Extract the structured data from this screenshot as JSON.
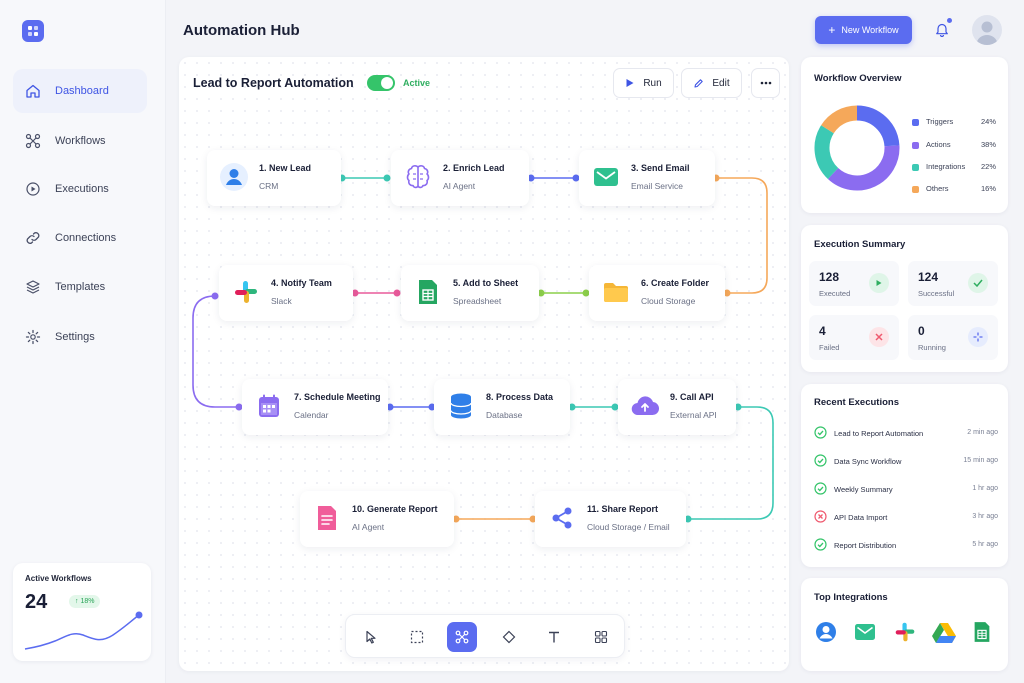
{
  "header": {
    "title": "Automation Hub",
    "new_workflow": "New Workflow"
  },
  "sidebar": {
    "items": [
      {
        "label": "Dashboard",
        "icon": "home-icon"
      },
      {
        "label": "Workflows",
        "icon": "workflow-icon"
      },
      {
        "label": "Executions",
        "icon": "play-circle-icon"
      },
      {
        "label": "Connections",
        "icon": "link-icon"
      },
      {
        "label": "Templates",
        "icon": "layers-icon"
      },
      {
        "label": "Settings",
        "icon": "gear-icon"
      }
    ],
    "active_card": {
      "title": "Active Workflows",
      "value": "24",
      "badge": "↑ 18%"
    }
  },
  "workflow": {
    "title": "Lead to Report Automation",
    "status": "Active",
    "run": "Run",
    "edit": "Edit",
    "nodes": [
      {
        "title": "1. New Lead",
        "sub": "CRM"
      },
      {
        "title": "2. Enrich Lead",
        "sub": "AI Agent"
      },
      {
        "title": "3. Send Email",
        "sub": "Email Service"
      },
      {
        "title": "4. Notify Team",
        "sub": "Slack"
      },
      {
        "title": "5. Add to Sheet",
        "sub": "Spreadsheet"
      },
      {
        "title": "6. Create Folder",
        "sub": "Cloud Storage"
      },
      {
        "title": "7. Schedule Meeting",
        "sub": "Calendar"
      },
      {
        "title": "8. Process Data",
        "sub": "Database"
      },
      {
        "title": "9. Call API",
        "sub": "External API"
      },
      {
        "title": "10. Generate Report",
        "sub": "AI Agent"
      },
      {
        "title": "11. Share Report",
        "sub": "Cloud Storage / Email"
      }
    ]
  },
  "overview": {
    "title": "Workflow Overview",
    "segments": [
      {
        "label": "Triggers",
        "pct": "24%",
        "value": 24,
        "color": "#5b6cf0"
      },
      {
        "label": "Actions",
        "pct": "38%",
        "value": 38,
        "color": "#8b6cf0"
      },
      {
        "label": "Integrations",
        "pct": "22%",
        "value": 22,
        "color": "#3cc9b4"
      },
      {
        "label": "Others",
        "pct": "16%",
        "value": 16,
        "color": "#f5a85a"
      }
    ]
  },
  "summary": {
    "title": "Execution Summary",
    "stats": [
      {
        "value": "128",
        "label": "Executed"
      },
      {
        "value": "124",
        "label": "Successful"
      },
      {
        "value": "4",
        "label": "Failed"
      },
      {
        "value": "0",
        "label": "Running"
      }
    ]
  },
  "recent": {
    "title": "Recent Executions",
    "rows": [
      {
        "name": "Lead to Report Automation",
        "time": "2 min ago",
        "status": "success"
      },
      {
        "name": "Data Sync Workflow",
        "time": "15 min ago",
        "status": "success"
      },
      {
        "name": "Weekly Summary",
        "time": "1 hr ago",
        "status": "success"
      },
      {
        "name": "API Data Import",
        "time": "3 hr ago",
        "status": "failed"
      },
      {
        "name": "Report Distribution",
        "time": "5 hr ago",
        "status": "success"
      }
    ]
  },
  "integrations": {
    "title": "Top Integrations"
  },
  "colors": {
    "accent": "#5b6cf0",
    "success": "#35c46a",
    "danger": "#ef5a6f"
  }
}
